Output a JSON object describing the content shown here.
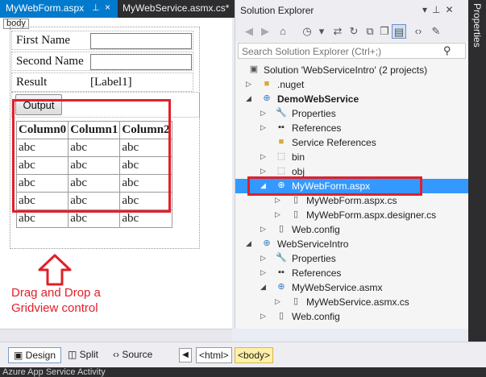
{
  "tabs": {
    "active": "MyWebForm.aspx",
    "inactive": "MyWebService.asmx.cs*",
    "pin_glyph": "⊥",
    "close_glyph": "×"
  },
  "designer": {
    "body_tag": "body",
    "form": {
      "first_name_label": "First Name",
      "second_name_label": "Second Name",
      "result_label": "Result",
      "result_value": "[Label1]",
      "output_button": "Output"
    },
    "grid": {
      "columns": [
        "Column0",
        "Column1",
        "Column2"
      ],
      "rows": [
        [
          "abc",
          "abc",
          "abc"
        ],
        [
          "abc",
          "abc",
          "abc"
        ],
        [
          "abc",
          "abc",
          "abc"
        ],
        [
          "abc",
          "abc",
          "abc"
        ],
        [
          "abc",
          "abc",
          "abc"
        ]
      ]
    },
    "annotation": "Drag and Drop a Gridview control",
    "accent_red": "#e0202a"
  },
  "view_bar": {
    "design": "Design",
    "split": "Split",
    "source": "Source",
    "html_tag": "<html>",
    "body_tag": "<body>"
  },
  "status_strip": "Azure App Service Activity",
  "solution_explorer": {
    "title": "Solution Explorer",
    "search_placeholder": "Search Solution Explorer (Ctrl+;)",
    "tree": [
      {
        "label": "Solution 'WebServiceIntro' (2 projects)",
        "icon": "solution-icon",
        "bold": false
      },
      {
        "label": ".nuget",
        "icon": "folder-icon",
        "bold": false
      },
      {
        "label": "DemoWebService",
        "icon": "web-project-icon",
        "bold": true
      },
      {
        "label": "Properties",
        "icon": "wrench-icon",
        "bold": false
      },
      {
        "label": "References",
        "icon": "references-icon",
        "bold": false
      },
      {
        "label": "Service References",
        "icon": "folder-icon",
        "bold": false
      },
      {
        "label": "bin",
        "icon": "dotted-folder-icon",
        "bold": false
      },
      {
        "label": "obj",
        "icon": "dotted-folder-icon",
        "bold": false
      },
      {
        "label": "MyWebForm.aspx",
        "icon": "globe-icon",
        "bold": false
      },
      {
        "label": "MyWebForm.aspx.cs",
        "icon": "cs-file-icon",
        "bold": false
      },
      {
        "label": "MyWebForm.aspx.designer.cs",
        "icon": "cs-file-icon",
        "bold": false
      },
      {
        "label": "Web.config",
        "icon": "config-icon",
        "bold": false
      },
      {
        "label": "WebServiceIntro",
        "icon": "web-project-icon",
        "bold": false
      },
      {
        "label": "Properties",
        "icon": "wrench-icon",
        "bold": false
      },
      {
        "label": "References",
        "icon": "references-icon",
        "bold": false
      },
      {
        "label": "MyWebService.asmx",
        "icon": "globe-icon",
        "bold": false
      },
      {
        "label": "MyWebService.asmx.cs",
        "icon": "cs-file-icon",
        "bold": false
      },
      {
        "label": "Web.config",
        "icon": "config-icon",
        "bold": false
      }
    ],
    "selected_item": "MyWebForm.aspx"
  },
  "properties_panel": "Properties",
  "colors": {
    "vs_blue": "#007acc",
    "selection": "#3399ff",
    "dark_chrome": "#2d2d30"
  }
}
